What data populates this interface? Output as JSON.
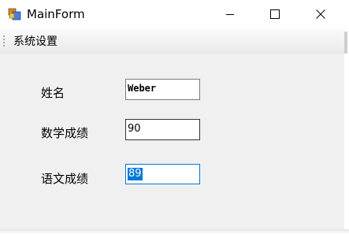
{
  "window": {
    "title": "MainForm",
    "icon": "form-app-icon",
    "controls": {
      "minimize": "minimize-icon",
      "maximize": "maximize-icon",
      "close": "close-icon"
    }
  },
  "menu": {
    "items": [
      {
        "label": "系统设置"
      }
    ]
  },
  "form": {
    "fields": [
      {
        "label": "姓名",
        "value": "Weber"
      },
      {
        "label": "数学成绩",
        "value": "90"
      },
      {
        "label": "语文成绩",
        "value": "89"
      }
    ]
  },
  "colors": {
    "selection": "#0078d7",
    "focus_border": "#0078d7",
    "window_background": "#f0f0f0"
  }
}
